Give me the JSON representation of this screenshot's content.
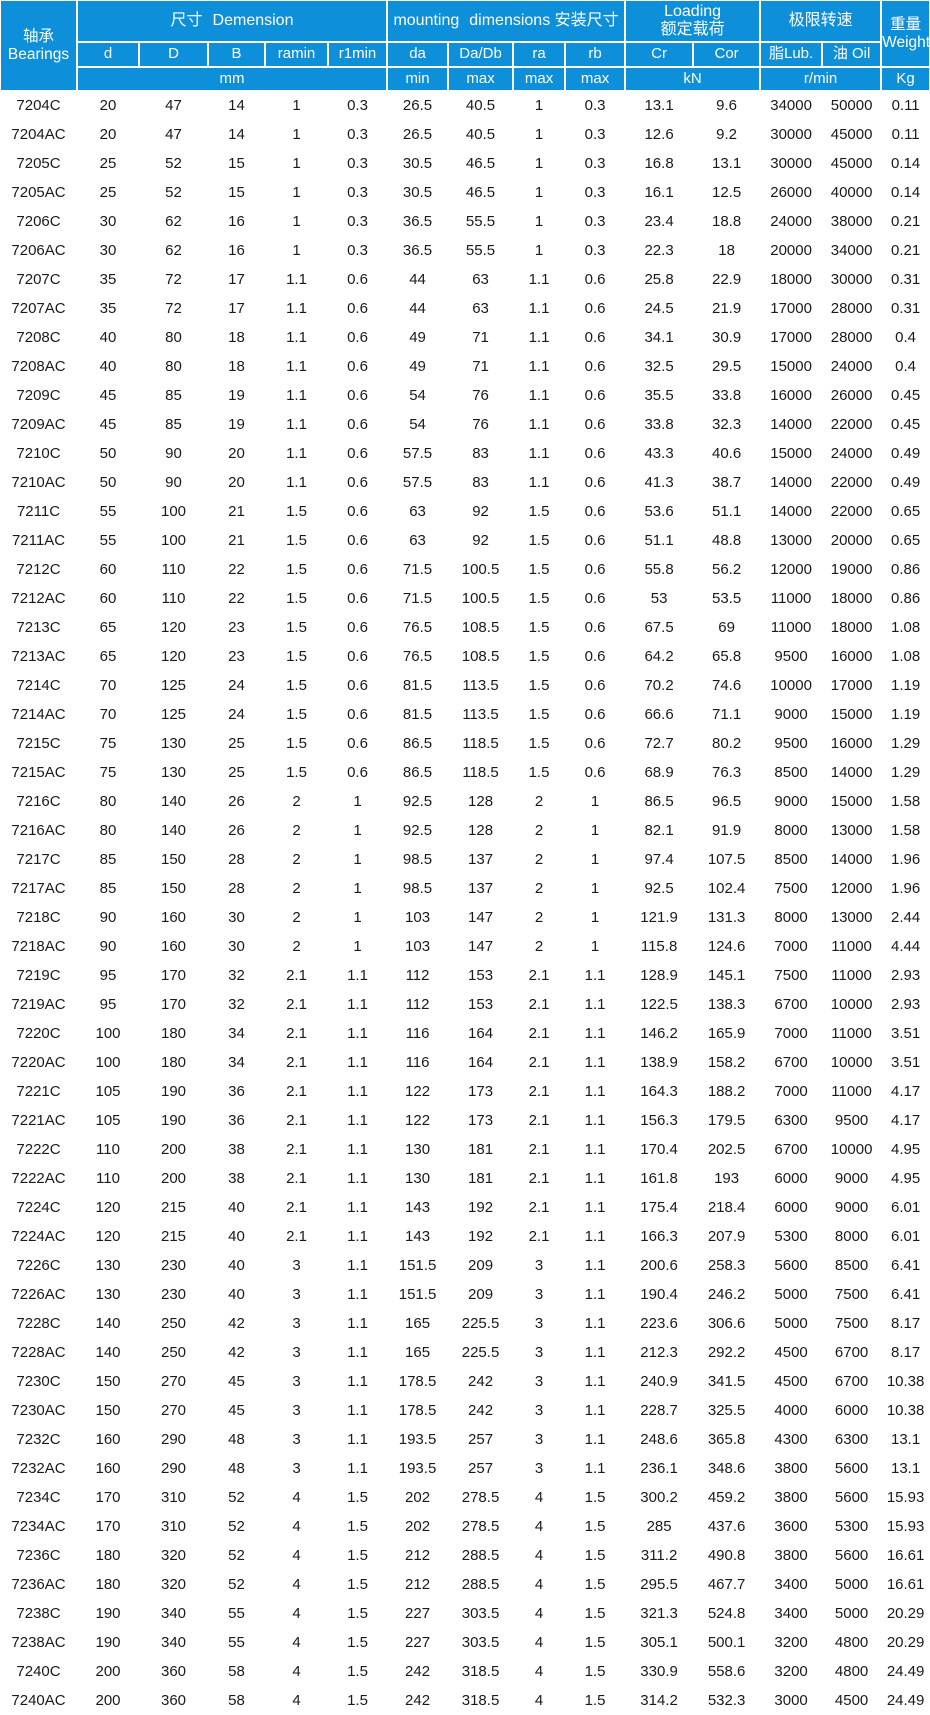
{
  "table": {
    "header": {
      "bearings": {
        "cn": "轴承",
        "en": "Bearings"
      },
      "dimension": {
        "cn": "尺寸",
        "en": "Demension"
      },
      "mounting": {
        "en1": "mounting",
        "en2": "dimensions",
        "cn": "安装尺寸"
      },
      "loading": {
        "en": "Loading",
        "cn": "额定载荷"
      },
      "speed": {
        "cn": "极限转速"
      },
      "weight": {
        "cn": "重量",
        "en": "Weight"
      },
      "sub": {
        "d": "d",
        "D": "D",
        "B": "B",
        "ramin": "ramin",
        "r1min": "r1min",
        "da": "da",
        "DaDb": "Da/Db",
        "ra": "ra",
        "rb": "rb",
        "Cr": "Cr",
        "Cor": "Cor",
        "lub": "脂Lub.",
        "oil_cn": "油",
        "oil_en": "Oil",
        "approx": "≈"
      },
      "units": {
        "mm": "mm",
        "min": "min",
        "max1": "max",
        "max2": "max",
        "max3": "max",
        "kN": "kN",
        "rmin": "r/min",
        "kg": "Kg"
      }
    },
    "columns": [
      "Bearings",
      "d",
      "D",
      "B",
      "ramin",
      "r1min",
      "da",
      "Da/Db",
      "ra",
      "rb",
      "Cr",
      "Cor",
      "脂Lub.",
      "油 Oil",
      "Weight"
    ],
    "rows": [
      [
        "7204C",
        "20",
        "47",
        "14",
        "1",
        "0.3",
        "26.5",
        "40.5",
        "1",
        "0.3",
        "13.1",
        "9.6",
        "34000",
        "50000",
        "0.11"
      ],
      [
        "7204AC",
        "20",
        "47",
        "14",
        "1",
        "0.3",
        "26.5",
        "40.5",
        "1",
        "0.3",
        "12.6",
        "9.2",
        "30000",
        "45000",
        "0.11"
      ],
      [
        "7205C",
        "25",
        "52",
        "15",
        "1",
        "0.3",
        "30.5",
        "46.5",
        "1",
        "0.3",
        "16.8",
        "13.1",
        "30000",
        "45000",
        "0.14"
      ],
      [
        "7205AC",
        "25",
        "52",
        "15",
        "1",
        "0.3",
        "30.5",
        "46.5",
        "1",
        "0.3",
        "16.1",
        "12.5",
        "26000",
        "40000",
        "0.14"
      ],
      [
        "7206C",
        "30",
        "62",
        "16",
        "1",
        "0.3",
        "36.5",
        "55.5",
        "1",
        "0.3",
        "23.4",
        "18.8",
        "24000",
        "38000",
        "0.21"
      ],
      [
        "7206AC",
        "30",
        "62",
        "16",
        "1",
        "0.3",
        "36.5",
        "55.5",
        "1",
        "0.3",
        "22.3",
        "18",
        "20000",
        "34000",
        "0.21"
      ],
      [
        "7207C",
        "35",
        "72",
        "17",
        "1.1",
        "0.6",
        "44",
        "63",
        "1.1",
        "0.6",
        "25.8",
        "22.9",
        "18000",
        "30000",
        "0.31"
      ],
      [
        "7207AC",
        "35",
        "72",
        "17",
        "1.1",
        "0.6",
        "44",
        "63",
        "1.1",
        "0.6",
        "24.5",
        "21.9",
        "17000",
        "28000",
        "0.31"
      ],
      [
        "7208C",
        "40",
        "80",
        "18",
        "1.1",
        "0.6",
        "49",
        "71",
        "1.1",
        "0.6",
        "34.1",
        "30.9",
        "17000",
        "28000",
        "0.4"
      ],
      [
        "7208AC",
        "40",
        "80",
        "18",
        "1.1",
        "0.6",
        "49",
        "71",
        "1.1",
        "0.6",
        "32.5",
        "29.5",
        "15000",
        "24000",
        "0.4"
      ],
      [
        "7209C",
        "45",
        "85",
        "19",
        "1.1",
        "0.6",
        "54",
        "76",
        "1.1",
        "0.6",
        "35.5",
        "33.8",
        "16000",
        "26000",
        "0.45"
      ],
      [
        "7209AC",
        "45",
        "85",
        "19",
        "1.1",
        "0.6",
        "54",
        "76",
        "1.1",
        "0.6",
        "33.8",
        "32.3",
        "14000",
        "22000",
        "0.45"
      ],
      [
        "7210C",
        "50",
        "90",
        "20",
        "1.1",
        "0.6",
        "57.5",
        "83",
        "1.1",
        "0.6",
        "43.3",
        "40.6",
        "15000",
        "24000",
        "0.49"
      ],
      [
        "7210AC",
        "50",
        "90",
        "20",
        "1.1",
        "0.6",
        "57.5",
        "83",
        "1.1",
        "0.6",
        "41.3",
        "38.7",
        "14000",
        "22000",
        "0.49"
      ],
      [
        "7211C",
        "55",
        "100",
        "21",
        "1.5",
        "0.6",
        "63",
        "92",
        "1.5",
        "0.6",
        "53.6",
        "51.1",
        "14000",
        "22000",
        "0.65"
      ],
      [
        "7211AC",
        "55",
        "100",
        "21",
        "1.5",
        "0.6",
        "63",
        "92",
        "1.5",
        "0.6",
        "51.1",
        "48.8",
        "13000",
        "20000",
        "0.65"
      ],
      [
        "7212C",
        "60",
        "110",
        "22",
        "1.5",
        "0.6",
        "71.5",
        "100.5",
        "1.5",
        "0.6",
        "55.8",
        "56.2",
        "12000",
        "19000",
        "0.86"
      ],
      [
        "7212AC",
        "60",
        "110",
        "22",
        "1.5",
        "0.6",
        "71.5",
        "100.5",
        "1.5",
        "0.6",
        "53",
        "53.5",
        "11000",
        "18000",
        "0.86"
      ],
      [
        "7213C",
        "65",
        "120",
        "23",
        "1.5",
        "0.6",
        "76.5",
        "108.5",
        "1.5",
        "0.6",
        "67.5",
        "69",
        "11000",
        "18000",
        "1.08"
      ],
      [
        "7213AC",
        "65",
        "120",
        "23",
        "1.5",
        "0.6",
        "76.5",
        "108.5",
        "1.5",
        "0.6",
        "64.2",
        "65.8",
        "9500",
        "16000",
        "1.08"
      ],
      [
        "7214C",
        "70",
        "125",
        "24",
        "1.5",
        "0.6",
        "81.5",
        "113.5",
        "1.5",
        "0.6",
        "70.2",
        "74.6",
        "10000",
        "17000",
        "1.19"
      ],
      [
        "7214AC",
        "70",
        "125",
        "24",
        "1.5",
        "0.6",
        "81.5",
        "113.5",
        "1.5",
        "0.6",
        "66.6",
        "71.1",
        "9000",
        "15000",
        "1.19"
      ],
      [
        "7215C",
        "75",
        "130",
        "25",
        "1.5",
        "0.6",
        "86.5",
        "118.5",
        "1.5",
        "0.6",
        "72.7",
        "80.2",
        "9500",
        "16000",
        "1.29"
      ],
      [
        "7215AC",
        "75",
        "130",
        "25",
        "1.5",
        "0.6",
        "86.5",
        "118.5",
        "1.5",
        "0.6",
        "68.9",
        "76.3",
        "8500",
        "14000",
        "1.29"
      ],
      [
        "7216C",
        "80",
        "140",
        "26",
        "2",
        "1",
        "92.5",
        "128",
        "2",
        "1",
        "86.5",
        "96.5",
        "9000",
        "15000",
        "1.58"
      ],
      [
        "7216AC",
        "80",
        "140",
        "26",
        "2",
        "1",
        "92.5",
        "128",
        "2",
        "1",
        "82.1",
        "91.9",
        "8000",
        "13000",
        "1.58"
      ],
      [
        "7217C",
        "85",
        "150",
        "28",
        "2",
        "1",
        "98.5",
        "137",
        "2",
        "1",
        "97.4",
        "107.5",
        "8500",
        "14000",
        "1.96"
      ],
      [
        "7217AC",
        "85",
        "150",
        "28",
        "2",
        "1",
        "98.5",
        "137",
        "2",
        "1",
        "92.5",
        "102.4",
        "7500",
        "12000",
        "1.96"
      ],
      [
        "7218C",
        "90",
        "160",
        "30",
        "2",
        "1",
        "103",
        "147",
        "2",
        "1",
        "121.9",
        "131.3",
        "8000",
        "13000",
        "2.44"
      ],
      [
        "7218AC",
        "90",
        "160",
        "30",
        "2",
        "1",
        "103",
        "147",
        "2",
        "1",
        "115.8",
        "124.6",
        "7000",
        "11000",
        "4.44"
      ],
      [
        "7219C",
        "95",
        "170",
        "32",
        "2.1",
        "1.1",
        "112",
        "153",
        "2.1",
        "1.1",
        "128.9",
        "145.1",
        "7500",
        "11000",
        "2.93"
      ],
      [
        "7219AC",
        "95",
        "170",
        "32",
        "2.1",
        "1.1",
        "112",
        "153",
        "2.1",
        "1.1",
        "122.5",
        "138.3",
        "6700",
        "10000",
        "2.93"
      ],
      [
        "7220C",
        "100",
        "180",
        "34",
        "2.1",
        "1.1",
        "116",
        "164",
        "2.1",
        "1.1",
        "146.2",
        "165.9",
        "7000",
        "11000",
        "3.51"
      ],
      [
        "7220AC",
        "100",
        "180",
        "34",
        "2.1",
        "1.1",
        "116",
        "164",
        "2.1",
        "1.1",
        "138.9",
        "158.2",
        "6700",
        "10000",
        "3.51"
      ],
      [
        "7221C",
        "105",
        "190",
        "36",
        "2.1",
        "1.1",
        "122",
        "173",
        "2.1",
        "1.1",
        "164.3",
        "188.2",
        "7000",
        "11000",
        "4.17"
      ],
      [
        "7221AC",
        "105",
        "190",
        "36",
        "2.1",
        "1.1",
        "122",
        "173",
        "2.1",
        "1.1",
        "156.3",
        "179.5",
        "6300",
        "9500",
        "4.17"
      ],
      [
        "7222C",
        "110",
        "200",
        "38",
        "2.1",
        "1.1",
        "130",
        "181",
        "2.1",
        "1.1",
        "170.4",
        "202.5",
        "6700",
        "10000",
        "4.95"
      ],
      [
        "7222AC",
        "110",
        "200",
        "38",
        "2.1",
        "1.1",
        "130",
        "181",
        "2.1",
        "1.1",
        "161.8",
        "193",
        "6000",
        "9000",
        "4.95"
      ],
      [
        "7224C",
        "120",
        "215",
        "40",
        "2.1",
        "1.1",
        "143",
        "192",
        "2.1",
        "1.1",
        "175.4",
        "218.4",
        "6000",
        "9000",
        "6.01"
      ],
      [
        "7224AC",
        "120",
        "215",
        "40",
        "2.1",
        "1.1",
        "143",
        "192",
        "2.1",
        "1.1",
        "166.3",
        "207.9",
        "5300",
        "8000",
        "6.01"
      ],
      [
        "7226C",
        "130",
        "230",
        "40",
        "3",
        "1.1",
        "151.5",
        "209",
        "3",
        "1.1",
        "200.6",
        "258.3",
        "5600",
        "8500",
        "6.41"
      ],
      [
        "7226AC",
        "130",
        "230",
        "40",
        "3",
        "1.1",
        "151.5",
        "209",
        "3",
        "1.1",
        "190.4",
        "246.2",
        "5000",
        "7500",
        "6.41"
      ],
      [
        "7228C",
        "140",
        "250",
        "42",
        "3",
        "1.1",
        "165",
        "225.5",
        "3",
        "1.1",
        "223.6",
        "306.6",
        "5000",
        "7500",
        "8.17"
      ],
      [
        "7228AC",
        "140",
        "250",
        "42",
        "3",
        "1.1",
        "165",
        "225.5",
        "3",
        "1.1",
        "212.3",
        "292.2",
        "4500",
        "6700",
        "8.17"
      ],
      [
        "7230C",
        "150",
        "270",
        "45",
        "3",
        "1.1",
        "178.5",
        "242",
        "3",
        "1.1",
        "240.9",
        "341.5",
        "4500",
        "6700",
        "10.38"
      ],
      [
        "7230AC",
        "150",
        "270",
        "45",
        "3",
        "1.1",
        "178.5",
        "242",
        "3",
        "1.1",
        "228.7",
        "325.5",
        "4000",
        "6000",
        "10.38"
      ],
      [
        "7232C",
        "160",
        "290",
        "48",
        "3",
        "1.1",
        "193.5",
        "257",
        "3",
        "1.1",
        "248.6",
        "365.8",
        "4300",
        "6300",
        "13.1"
      ],
      [
        "7232AC",
        "160",
        "290",
        "48",
        "3",
        "1.1",
        "193.5",
        "257",
        "3",
        "1.1",
        "236.1",
        "348.6",
        "3800",
        "5600",
        "13.1"
      ],
      [
        "7234C",
        "170",
        "310",
        "52",
        "4",
        "1.5",
        "202",
        "278.5",
        "4",
        "1.5",
        "300.2",
        "459.2",
        "3800",
        "5600",
        "15.93"
      ],
      [
        "7234AC",
        "170",
        "310",
        "52",
        "4",
        "1.5",
        "202",
        "278.5",
        "4",
        "1.5",
        "285",
        "437.6",
        "3600",
        "5300",
        "15.93"
      ],
      [
        "7236C",
        "180",
        "320",
        "52",
        "4",
        "1.5",
        "212",
        "288.5",
        "4",
        "1.5",
        "311.2",
        "490.8",
        "3800",
        "5600",
        "16.61"
      ],
      [
        "7236AC",
        "180",
        "320",
        "52",
        "4",
        "1.5",
        "212",
        "288.5",
        "4",
        "1.5",
        "295.5",
        "467.7",
        "3400",
        "5000",
        "16.61"
      ],
      [
        "7238C",
        "190",
        "340",
        "55",
        "4",
        "1.5",
        "227",
        "303.5",
        "4",
        "1.5",
        "321.3",
        "524.8",
        "3400",
        "5000",
        "20.29"
      ],
      [
        "7238AC",
        "190",
        "340",
        "55",
        "4",
        "1.5",
        "227",
        "303.5",
        "4",
        "1.5",
        "305.1",
        "500.1",
        "3200",
        "4800",
        "20.29"
      ],
      [
        "7240C",
        "200",
        "360",
        "58",
        "4",
        "1.5",
        "242",
        "318.5",
        "4",
        "1.5",
        "330.9",
        "558.6",
        "3200",
        "4800",
        "24.49"
      ],
      [
        "7240AC",
        "200",
        "360",
        "58",
        "4",
        "1.5",
        "242",
        "318.5",
        "4",
        "1.5",
        "314.2",
        "532.3",
        "3000",
        "4500",
        "24.49"
      ]
    ]
  },
  "colors": {
    "header_blue": "#0d8fd9",
    "row_highlight": "#9ed8f5",
    "row_base": "#ffffff",
    "text": "#1a1a1a"
  }
}
